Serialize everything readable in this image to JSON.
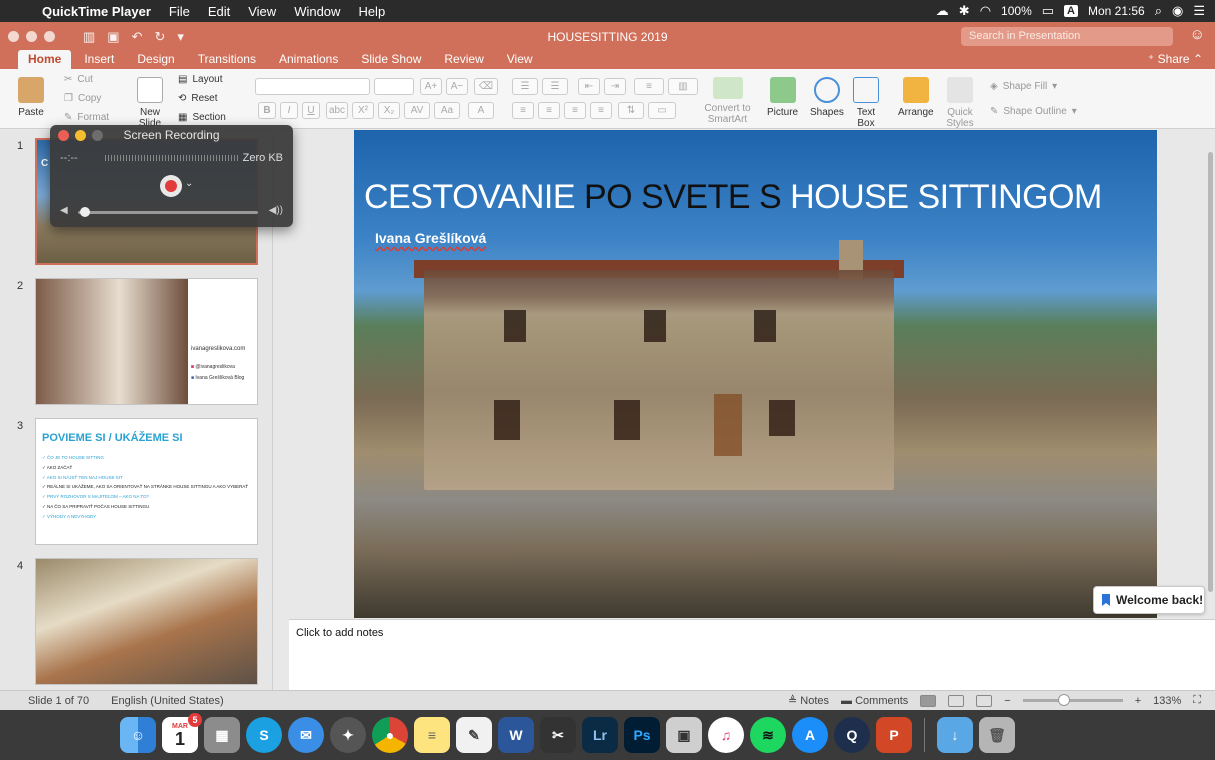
{
  "menubar": {
    "app": "QuickTime Player",
    "items": [
      "File",
      "Edit",
      "View",
      "Window",
      "Help"
    ],
    "battery": "100%",
    "input_badge": "A",
    "clock": "Mon 21:56"
  },
  "window": {
    "title": "HOUSESITTING 2019",
    "search_placeholder": "Search in Presentation",
    "share": "Share"
  },
  "ribbon_tabs": [
    "Home",
    "Insert",
    "Design",
    "Transitions",
    "Animations",
    "Slide Show",
    "Review",
    "View"
  ],
  "ribbon": {
    "paste": "Paste",
    "cut": "Cut",
    "copy": "Copy",
    "format": "Format",
    "new_slide": "New Slide",
    "layout": "Layout",
    "reset": "Reset",
    "section": "Section",
    "convert": "Convert to SmartArt",
    "picture": "Picture",
    "shapes": "Shapes",
    "text_box": "Text Box",
    "arrange": "Arrange",
    "quick_styles": "Quick Styles",
    "shape_fill": "Shape Fill",
    "shape_outline": "Shape Outline"
  },
  "recording": {
    "title": "Screen Recording",
    "time": "--:--",
    "size": "Zero KB"
  },
  "thumbnails": [
    {
      "number": "1",
      "initial": "C"
    },
    {
      "number": "2",
      "site": "ivanagreslikova.com",
      "instagram": "@ivanagreslikova",
      "facebook": "Ivana Grešlíková Blog"
    },
    {
      "number": "3",
      "heading": "POVIEME SI / UKÁŽEME SI",
      "items": [
        "ČO JE TO HOUSE SITTING",
        "AKO ZAČAŤ",
        "AKO SI NÁJSŤ TEN NAJ HOUSE SIT",
        "REÁLNE SI UKÁŽEME, AKO SA ORIENTOVAŤ NA STRÁNKE HOUSE SITTINGU A AKO VYBERAŤ",
        "PRVÝ ROZHOVOR S MAJITEĽOM – AKO NA TO?",
        "NA ČO SA PRIPRAVIŤ POČAS HOUSE SITTINGU",
        "VÝHODY A NEVÝHODY"
      ]
    },
    {
      "number": "4"
    }
  ],
  "slide": {
    "title_part1": "CESTOVANIE ",
    "title_part2": "PO SVETE S",
    "title_part3": " HOUSE SITTINGOM",
    "subtitle": "Ivana Grešlíková"
  },
  "welcome": "Welcome back!",
  "notes_placeholder": "Click to add notes",
  "status": {
    "slide_counter": "Slide 1 of 70",
    "language": "English (United States)",
    "notes": "Notes",
    "comments": "Comments",
    "zoom": "133%"
  },
  "dock": {
    "calendar_month": "MAR",
    "calendar_day": "1",
    "calendar_badge": "5",
    "apps": [
      "Finder",
      "Calendar",
      "Calculator",
      "Skype",
      "Mail",
      "Launchpad",
      "Chrome",
      "Notes",
      "TextEdit",
      "Word",
      "Final Cut",
      "Lightroom",
      "Photoshop",
      "Preview",
      "iTunes",
      "Spotify",
      "App Store",
      "QuickTime",
      "PowerPoint",
      "Downloads",
      "Trash"
    ]
  }
}
